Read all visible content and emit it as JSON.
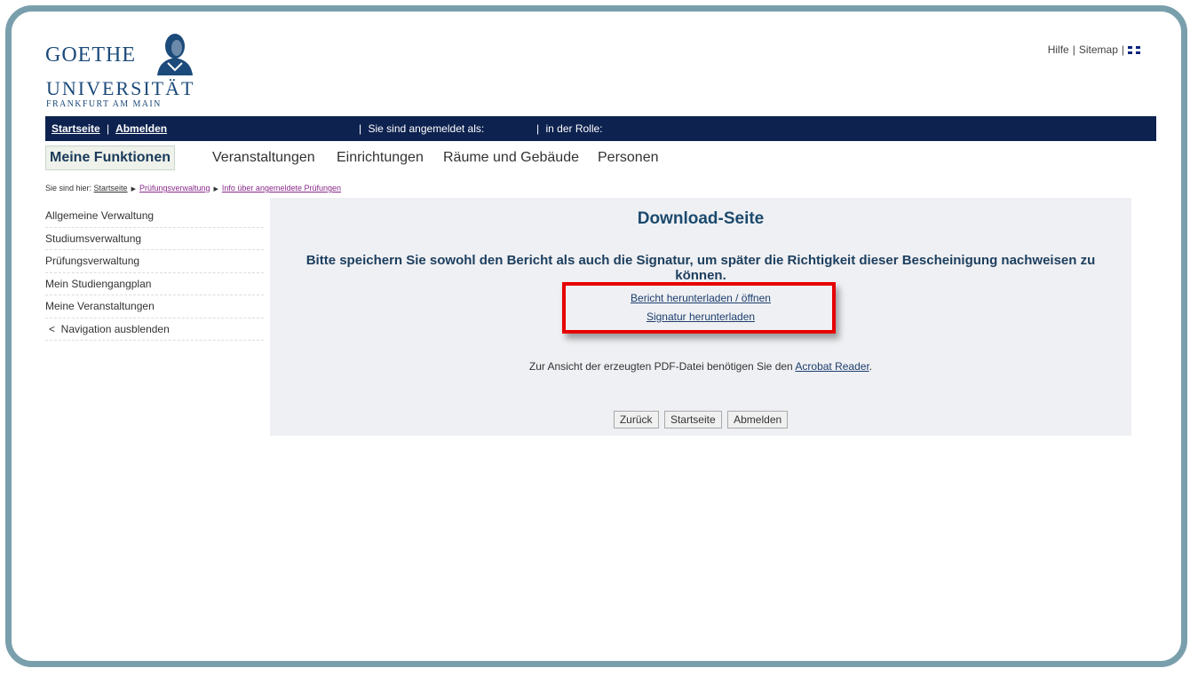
{
  "logo": {
    "line1": "GOETHE",
    "line2": "UNIVERSITÄT",
    "line3": "FRANKFURT AM MAIN"
  },
  "toplinks": {
    "help": "Hilfe",
    "sitemap": "Sitemap",
    "separator": "|",
    "language_icon": "uk-flag-icon"
  },
  "navbar": {
    "home": "Startseite",
    "logout": "Abmelden",
    "separator": "|",
    "logged_in_as": "Sie sind angemeldet als:",
    "role": "in der Rolle:"
  },
  "mainmenu": {
    "active": "Meine Funktionen",
    "items": [
      "Veranstaltungen",
      "Einrichtungen",
      "Räume und Gebäude",
      "Personen"
    ]
  },
  "breadcrumb": {
    "prefix": "Sie sind hier:",
    "items": [
      "Startseite",
      "Prüfungsverwaltung",
      "Info über angemeldete Prüfungen"
    ]
  },
  "sidenav": {
    "items": [
      "Allgemeine Verwaltung",
      "Studiumsverwaltung",
      "Prüfungsverwaltung",
      "Mein Studiengangplan",
      "Meine Veranstaltungen",
      "<  Navigation ausblenden"
    ]
  },
  "content": {
    "title": "Download-Seite",
    "message": "Bitte speichern Sie sowohl den Bericht als auch die Signatur, um später die Richtigkeit dieser Bescheinigung nachweisen zu können.",
    "download_report": "Bericht herunterladen / öffnen",
    "download_signature": "Signatur herunterladen",
    "info_prefix": "Zur Ansicht der erzeugten PDF-Datei benötigen Sie den",
    "info_link": "Acrobat Reader",
    "info_suffix": ".",
    "buttons": [
      "Zurück",
      "Startseite",
      "Abmelden"
    ]
  },
  "colors": {
    "navbar": "#0e2250",
    "content_bg": "#eff0f3",
    "title": "#1c4a6e",
    "highlight": "#e60000",
    "frame": "#7a9fac"
  }
}
